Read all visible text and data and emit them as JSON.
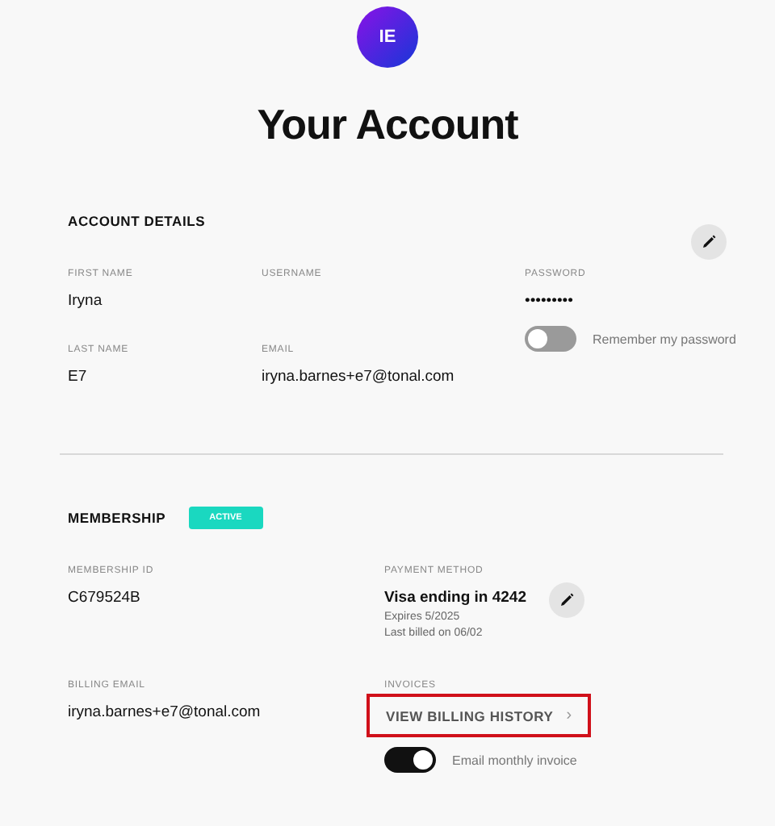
{
  "avatar": {
    "initials": "IE"
  },
  "title": "Your Account",
  "account_details": {
    "heading": "ACCOUNT DETAILS",
    "fields": [
      {
        "label": "FIRST NAME",
        "value": "Iryna"
      },
      {
        "label": "USERNAME"
      },
      {
        "label": "PASSWORD",
        "value": "•••••••••"
      },
      {
        "label": "LAST NAME",
        "value": "E7"
      },
      {
        "label": "EMAIL",
        "value": "iryna.barnes+e7@tonal.com"
      }
    ],
    "remember_password": {
      "label": "Remember my password",
      "on": false
    }
  },
  "membership": {
    "heading": "MEMBERSHIP",
    "status": "ACTIVE",
    "membership_id": {
      "label": "MEMBERSHIP ID",
      "value": "C679524B"
    },
    "payment_method": {
      "label": "PAYMENT METHOD",
      "value": "Visa ending in 4242",
      "expires": "Expires 5/2025",
      "last_billed": "Last billed on 06/02"
    },
    "billing_email": {
      "label": "BILLING EMAIL",
      "value": "iryna.barnes+e7@tonal.com"
    },
    "invoices": {
      "label": "INVOICES",
      "link": "VIEW BILLING HISTORY",
      "highlighted": true,
      "chevron": "›",
      "email_monthly": {
        "label": "Email monthly invoice",
        "on": true
      }
    }
  }
}
